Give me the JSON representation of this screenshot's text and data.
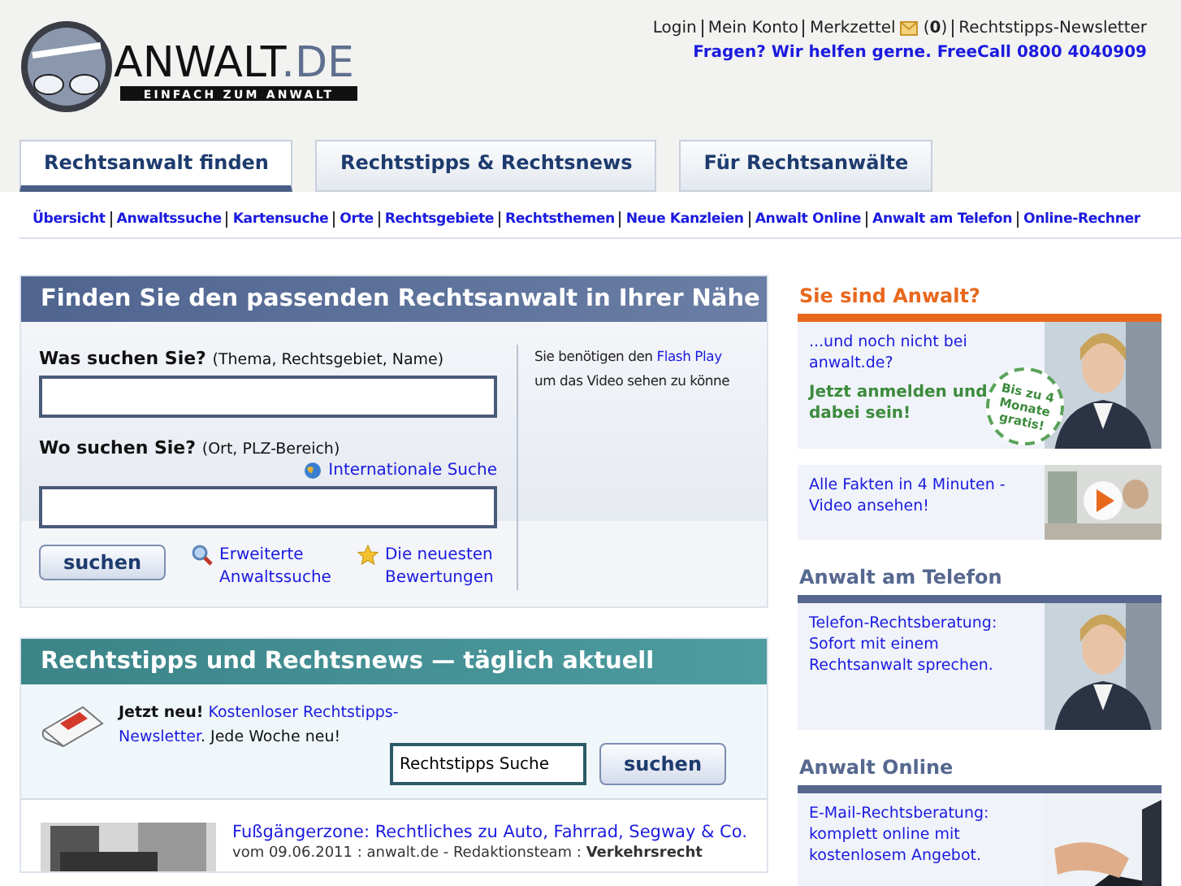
{
  "logo": {
    "name": "ANWALT",
    "suffix": ".DE",
    "tagline": "EINFACH ZUM ANWALT"
  },
  "top_links": [
    {
      "label": "Login"
    },
    {
      "label": "Mein Konto"
    },
    {
      "label": "Merkzettel",
      "count": "(**0**)"
    },
    {
      "label": "Rechtstipps-Newsletter"
    }
  ],
  "hotline": "Fragen? Wir helfen gerne. FreeCall 0800 4040909",
  "tabs": [
    {
      "label": "Rechtsanwalt finden",
      "selected": true
    },
    {
      "label": "Rechtstipps & Rechtsnews",
      "selected": false
    },
    {
      "label": "Für Rechtsanwälte",
      "selected": false
    }
  ],
  "subnav": [
    "Übersicht",
    "Anwaltssuche",
    "Kartensuche",
    "Orte",
    "Rechtsgebiete",
    "Rechtsthemen",
    "Neue Kanzleien",
    "Anwalt Online",
    "Anwalt am Telefon",
    "Online-Rechner"
  ],
  "finder": {
    "title": "Finden Sie den passenden Rechtsanwalt in Ihrer Nähe",
    "fields": [
      {
        "label": "Was suchen Sie?",
        "hint": "(Thema, Rechtsgebiet, Name)"
      },
      {
        "label": "Wo suchen Sie?",
        "hint": "(Ort, PLZ-Bereich)",
        "link": "Internationale Suche"
      }
    ],
    "button": "suchen",
    "links": [
      {
        "kind": "search",
        "lines": [
          "Erweiterte",
          "Anwaltssuche"
        ]
      },
      {
        "kind": "star",
        "lines": [
          "Die neuesten",
          "Bewertungen"
        ]
      }
    ],
    "flash_lines": [
      {
        "text": "Sie benötigen den ",
        "link": "Flash Play"
      },
      {
        "text": "um das Video sehen zu könne"
      }
    ]
  },
  "news": {
    "title": "Rechtstipps und Rechtsnews — täglich aktuell",
    "promo": "**Jetzt neu!** ",
    "promo_link": [
      "Kostenloser Rechtstipps-",
      "Newsletter"
    ],
    "promo_tail": ". Jede Woche neu!",
    "search_value": "Rechtstipps Suche",
    "button": "suchen",
    "articles": [
      {
        "title": "Fußgängerzone: Rechtliches zu Auto, Fahrrad, Segway & Co.",
        "meta": "vom 09.06.2011 : anwalt.de - Redaktionsteam : **Verkehrsrecht**"
      }
    ]
  },
  "sidebar": [
    {
      "heading": "Sie sind Anwalt?",
      "color": "#e8681e",
      "cards": [
        {
          "kind": "promo",
          "text": "...und noch nicht bei anwalt.de?",
          "cta": "Jetzt anmelden und dabei sein!",
          "badge": "Bis zu 4 Monate gratis!"
        },
        {
          "kind": "video",
          "text": "Alle Fakten in 4 Minuten - Video ansehen!"
        }
      ]
    },
    {
      "heading": "Anwalt am Telefon",
      "color": "#56688f",
      "cards": [
        {
          "kind": "phone",
          "text": "Telefon-Rechtsberatung: Sofort mit einem Rechtsanwalt sprechen."
        }
      ]
    },
    {
      "heading": "Anwalt Online",
      "color": "#56688f",
      "cards": [
        {
          "kind": "email",
          "text": "E-Mail-Rechtsberatung: komplett online mit kostenlosem Angebot."
        }
      ]
    }
  ]
}
